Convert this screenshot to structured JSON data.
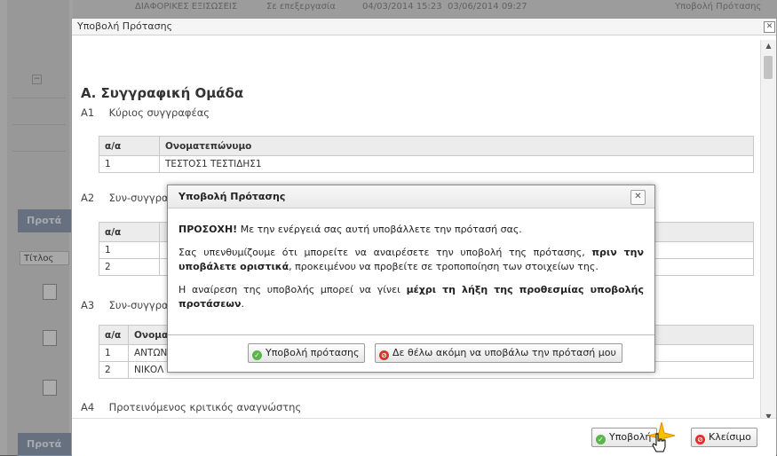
{
  "background": {
    "top_row": [
      "ΔΙΑΦΟΡΙΚΕΣ ΕΞΙΣΩΣΕΙΣ",
      "Σε επεξεργασία",
      "04/03/2014 15:23",
      "03/06/2014 09:27",
      "Υποβολή Πρότασης"
    ],
    "panel_header_1": "Προτά",
    "panel_header_2": "Προτά",
    "tab_label": "Τίτλος"
  },
  "outer_dialog": {
    "title": "Υποβολή Πρότασης",
    "close_glyph": "✕",
    "section_title": "Α. Συγγραφική Ομάδα",
    "subsections": [
      {
        "code": "A1",
        "label": "Κύριος συγγραφέας"
      },
      {
        "code": "A2",
        "label": "Συν-συγγραφείς (εντός ιδρύματος)"
      },
      {
        "code": "A3",
        "label": "Συν-συγγραφείς"
      },
      {
        "code": "A4",
        "label": "Προτεινόμενος κριτικός αναγνώστης"
      }
    ],
    "table_a1": {
      "headers": [
        "α/α",
        "Ονοματεπώνυμο"
      ],
      "rows": [
        [
          "1",
          "ΤΕΣΤΟΣ1 ΤΕΣΤΙΔΗΣ1"
        ]
      ]
    },
    "table_a2": {
      "headers": [
        "α/α"
      ],
      "rows": [
        [
          "1"
        ],
        [
          "2"
        ]
      ]
    },
    "table_a3": {
      "headers": [
        "α/α",
        "Ονομα"
      ],
      "rows": [
        [
          "1",
          "ΑΝΤΩΝ"
        ],
        [
          "2",
          "ΝΙΚΟΛ"
        ]
      ]
    },
    "submit_button": "Υποβολή",
    "close_button": "Κλείσιμο"
  },
  "confirm_modal": {
    "title": "Υποβολή Πρότασης",
    "close_glyph": "✕",
    "warning_bold": "ΠΡΟΣΟΧΗ!",
    "warning_text": " Με την ενέργειά σας αυτή υποβάλλετε την πρότασή σας.",
    "reminder_1": "Σας υπενθυμίζουμε ότι μπορείτε να αναιρέσετε την υποβολή της πρότασης, ",
    "reminder_bold_1": "πριν την υποβάλετε οριστικά",
    "reminder_2": ", προκειμένου να προβείτε σε τροποποίηση των στοιχείων της.",
    "undo_1": "Η αναίρεση της υποβολής μπορεί να γίνει ",
    "undo_bold": "μέχρι τη λήξη της προθεσμίας υποβολής προτάσεων",
    "undo_2": ".",
    "confirm_button": "Υποβολή πρότασης",
    "cancel_button": "Δε θέλω ακόμη να υποβάλω την πρότασή μου"
  },
  "colors": {
    "ok_icon": "#5ab54a",
    "cancel_icon": "#e0302b",
    "header_bg": "#7d8da3"
  }
}
